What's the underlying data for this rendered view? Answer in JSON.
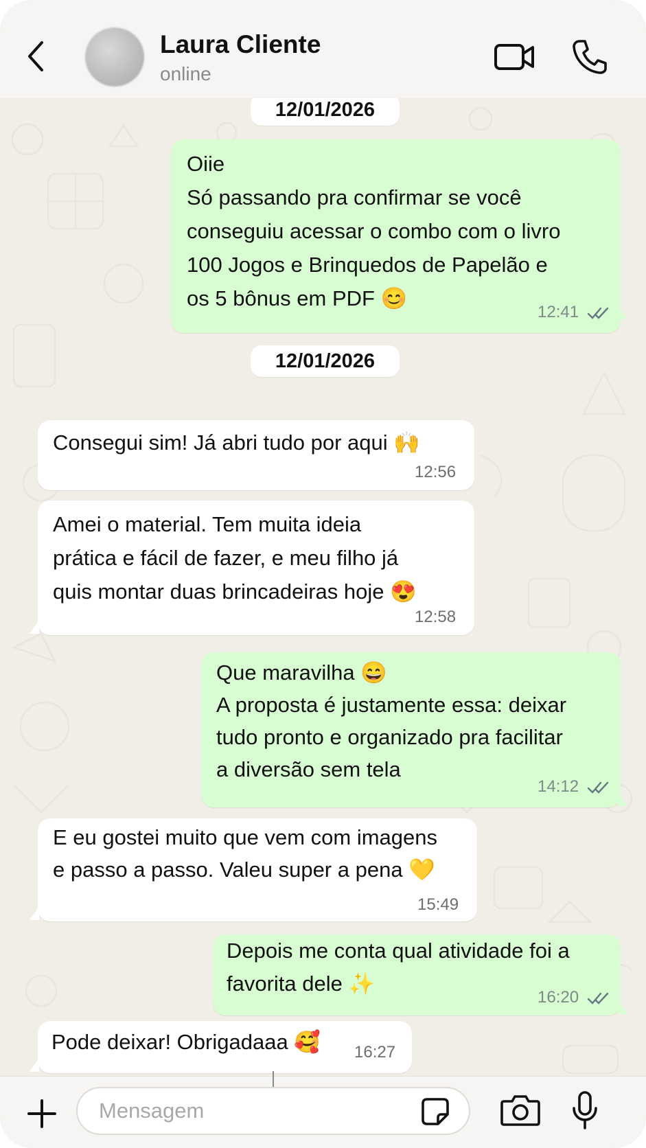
{
  "header": {
    "back_icon": "chevron-left-icon",
    "contact_name": "Laura Cliente",
    "contact_status": "online",
    "video_icon": "video-camera-icon",
    "call_icon": "phone-icon"
  },
  "dates": [
    "12/01/2026",
    "12/01/2026"
  ],
  "messages": [
    {
      "direction": "out",
      "text": "Oiie\nSó passando pra confirmar se você\nconseguiu acessar o combo com o livro\n100 Jogos e Brinquedos de Papelão e\nos 5 bônus em PDF 😊",
      "time": "12:41",
      "status": "read"
    },
    {
      "direction": "in",
      "text": "Consegui sim! Já abri tudo por aqui 🙌",
      "time": "12:56"
    },
    {
      "direction": "in",
      "text": "Amei o material. Tem muita ideia\nprática e fácil de fazer, e meu filho já\nquis montar duas brincadeiras hoje 😍",
      "time": "12:58"
    },
    {
      "direction": "out",
      "text": "Que maravilha 😄\nA proposta é justamente essa: deixar\ntudo pronto e organizado pra facilitar\na diversão sem tela",
      "time": "14:12",
      "status": "read"
    },
    {
      "direction": "in",
      "text": "E eu gostei muito que vem com imagens\ne passo a passo. Valeu super a pena 💛",
      "time": "15:49"
    },
    {
      "direction": "out",
      "text": "Depois me conta qual atividade foi a\nfavorita dele ✨",
      "time": "16:20",
      "status": "read"
    },
    {
      "direction": "in",
      "text": "Pode deixar! Obrigadaaa 🥰",
      "time": "16:27"
    }
  ],
  "composer": {
    "plus_icon": "plus-icon",
    "placeholder": "Mensagem",
    "sticker_icon": "sticker-icon",
    "camera_icon": "camera-icon",
    "mic_icon": "microphone-icon"
  },
  "colors": {
    "outgoing_bubble": "#d9fdd3",
    "incoming_bubble": "#ffffff",
    "chat_background": "#f1ede7",
    "header_background": "#f6f5f3"
  }
}
